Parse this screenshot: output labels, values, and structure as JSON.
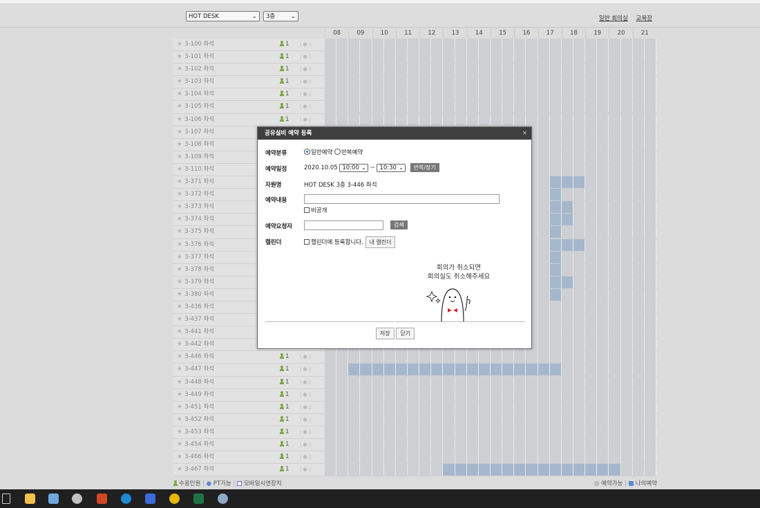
{
  "toolbar": {
    "category_select": "HOT DESK",
    "floor_select": "3층",
    "links": [
      "일반 회의실",
      "교육장"
    ]
  },
  "hours": [
    "08",
    "09",
    "10",
    "11",
    "12",
    "13",
    "14",
    "15",
    "16",
    "17",
    "18",
    "19",
    "20",
    "21"
  ],
  "rows": [
    {
      "name": "3-100 좌석",
      "capacity": "1",
      "booked": []
    },
    {
      "name": "3-101 좌석",
      "capacity": "1",
      "booked": []
    },
    {
      "name": "3-102 좌석",
      "capacity": "1",
      "booked": []
    },
    {
      "name": "3-103 좌석",
      "capacity": "1",
      "booked": []
    },
    {
      "name": "3-104 좌석",
      "capacity": "1",
      "booked": []
    },
    {
      "name": "3-105 좌석",
      "capacity": "1",
      "booked": []
    },
    {
      "name": "3-106 좌석",
      "capacity": "1",
      "booked": []
    },
    {
      "name": "3-107 좌석",
      "capacity": "1",
      "booked": []
    },
    {
      "name": "3-108 좌석",
      "capacity": "1",
      "booked": []
    },
    {
      "name": "3-109 좌석",
      "capacity": "1",
      "booked": []
    },
    {
      "name": "3-110 좌석",
      "capacity": "1",
      "booked": []
    },
    {
      "name": "3-371 좌석",
      "capacity": "1",
      "booked": [
        [
          17.5,
          19
        ]
      ]
    },
    {
      "name": "3-372 좌석",
      "capacity": "1",
      "booked": [
        [
          17.5,
          18
        ]
      ]
    },
    {
      "name": "3-373 좌석",
      "capacity": "1",
      "booked": [
        [
          17.5,
          18.5
        ]
      ]
    },
    {
      "name": "3-374 좌석",
      "capacity": "1",
      "booked": [
        [
          17.5,
          18.5
        ]
      ]
    },
    {
      "name": "3-375 좌석",
      "capacity": "1",
      "booked": [
        [
          17.5,
          18
        ]
      ]
    },
    {
      "name": "3-376 좌석",
      "capacity": "1",
      "booked": [
        [
          17.5,
          19
        ]
      ]
    },
    {
      "name": "3-377 좌석",
      "capacity": "1",
      "booked": [
        [
          17.5,
          18
        ]
      ]
    },
    {
      "name": "3-378 좌석",
      "capacity": "1",
      "booked": [
        [
          17.5,
          18
        ]
      ]
    },
    {
      "name": "3-379 좌석",
      "capacity": "1",
      "booked": [
        [
          17.5,
          18.5
        ]
      ]
    },
    {
      "name": "3-380 좌석",
      "capacity": "1",
      "booked": [
        [
          17.5,
          18
        ]
      ]
    },
    {
      "name": "3-436 좌석",
      "capacity": "1",
      "booked": []
    },
    {
      "name": "3-437 좌석",
      "capacity": "1",
      "booked": []
    },
    {
      "name": "3-441 좌석",
      "capacity": "1",
      "booked": []
    },
    {
      "name": "3-442 좌석",
      "capacity": "1",
      "booked": []
    },
    {
      "name": "3-446 좌석",
      "capacity": "1",
      "booked": []
    },
    {
      "name": "3-447 좌석",
      "capacity": "1",
      "booked": [
        [
          9,
          18
        ]
      ]
    },
    {
      "name": "3-448 좌석",
      "capacity": "1",
      "booked": []
    },
    {
      "name": "3-449 좌석",
      "capacity": "1",
      "booked": []
    },
    {
      "name": "3-451 좌석",
      "capacity": "1",
      "booked": []
    },
    {
      "name": "3-452 좌석",
      "capacity": "1",
      "booked": []
    },
    {
      "name": "3-453 좌석",
      "capacity": "1",
      "booked": []
    },
    {
      "name": "3-454 좌석",
      "capacity": "1",
      "booked": []
    },
    {
      "name": "3-466 좌석",
      "capacity": "1",
      "booked": []
    },
    {
      "name": "3-467 좌석",
      "capacity": "1",
      "booked": [
        [
          13,
          20.5
        ]
      ]
    }
  ],
  "legend": {
    "capacity": "수용인원",
    "pt": "PT가능",
    "mobile": "모바일시연장치",
    "available": "예약가능",
    "mine": "나의예약"
  },
  "dialog": {
    "title": "공유설비 예약 등록",
    "category_label": "예약분류",
    "opt_normal": "일반예약",
    "opt_repeat": "반복예약",
    "schedule_label": "예약일정",
    "date": "2020.10.05",
    "start": "10:00",
    "tilde": "~",
    "end": "10:30",
    "repeat_btn": "반복/장기",
    "resource_label": "자원명",
    "resource_value": "HOT DESK  3층  3-446 좌석",
    "content_label": "예약내용",
    "private_label": "비공개",
    "requester_label": "예약요청자",
    "search_btn": "검색",
    "calendar_label": "캘린더",
    "calendar_check": "캘린더에 등록합니다.",
    "my_calendar_btn": "내 캘린더",
    "note_line1": "회의가 취소되면",
    "note_line2": "회의실도 취소해주세요",
    "save_btn": "저장",
    "close_btn": "닫기"
  },
  "colors": {
    "booked": "#a5b7cc",
    "grid": "#cdcfd3",
    "mine": "#5b8ad6"
  }
}
